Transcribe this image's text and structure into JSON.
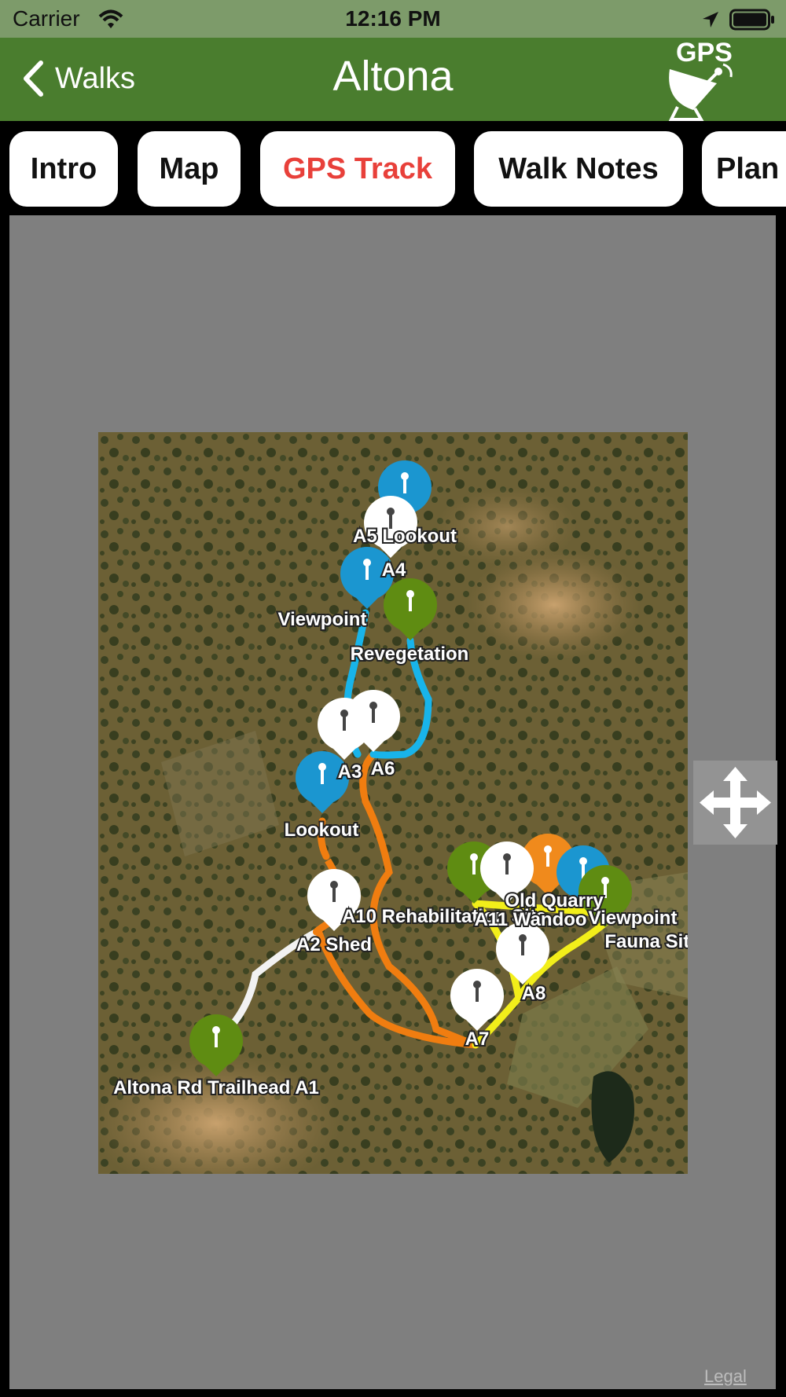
{
  "status_bar": {
    "carrier": "Carrier",
    "time": "12:16 PM"
  },
  "nav_bar": {
    "back_label": "Walks",
    "title": "Altona",
    "logo_text": "GPS"
  },
  "tabs": [
    {
      "label": "Intro",
      "active": false
    },
    {
      "label": "Map",
      "active": false
    },
    {
      "label": "GPS Track",
      "active": true
    },
    {
      "label": "Walk Notes",
      "active": false
    },
    {
      "label": "Plan",
      "active": false
    }
  ],
  "map": {
    "labels": {
      "lookout_a5": "A5 Lookout",
      "a4": "A4",
      "viewpoint_top": "Viewpoint",
      "revegetation": "Revegetation",
      "a3": "A3",
      "a6": "A6",
      "lookout": "Lookout",
      "a10_rehab": "A10 Rehabilitation Site",
      "old_quarry": "Old Quarry",
      "a11": "A11 Wandoo",
      "viewpoint_right": "Viewpoint",
      "fauna_site": "Fauna Site",
      "a2_shed": "A2 Shed",
      "a8": "A8",
      "a7": "A7",
      "trailhead": "Altona Rd Trailhead A1"
    },
    "pin_colors": {
      "white": "#ffffff",
      "blue": "#1b96d0",
      "green": "#5f8c12",
      "orange": "#f08a1c"
    },
    "route_colors": {
      "orange": "#f07d10",
      "blue": "#18b4ea",
      "white": "#f2f2f2",
      "yellow": "#f2ee1a"
    }
  },
  "legal": "Legal"
}
